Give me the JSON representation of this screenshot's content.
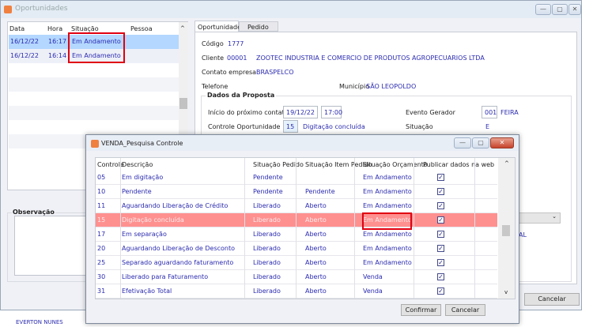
{
  "main_window": {
    "title": "Oportunidades",
    "min": "—",
    "max": "▢",
    "close": "✕"
  },
  "list": {
    "headers": [
      "Data",
      "Hora",
      "Situação",
      "Pessoa"
    ],
    "rows": [
      {
        "data": "16/12/22",
        "hora": "16:17",
        "situacao": "Em Andamento",
        "pessoa": ""
      },
      {
        "data": "16/12/22",
        "hora": "16:14",
        "situacao": "Em Andamento",
        "pessoa": ""
      }
    ],
    "scroll_up": "^"
  },
  "observacao_label": "Observação",
  "tabs": [
    "Oportunidade",
    "Pedido"
  ],
  "form": {
    "codigo_label": "Código",
    "codigo": "1777",
    "cliente_label": "Cliente",
    "cliente_codigo": "00001",
    "cliente_nome": "ZOOTEC INDUSTRIA E COMERCIO DE PRODUTOS AGROPECUARIOS LTDA",
    "contato_label": "Contato empresa",
    "contato": "BRASPELCO",
    "telefone_label": "Telefone",
    "municipio_label": "Município",
    "municipio": "SÃO LEOPOLDO",
    "group_title": "Dados da Proposta",
    "inicio_label": "Início do próximo contato",
    "inicio_data": "19/12/22",
    "inicio_hora": "17:00",
    "evento_label": "Evento Gerador",
    "evento_codigo": "001",
    "evento_nome": "FEIRA",
    "controle_label": "Controle Oportunidade",
    "controle_codigo": "15",
    "controle_desc": "Digitação concluída",
    "situacao_label": "Situação",
    "situacao": "E",
    "partial_text": "AL"
  },
  "main_cancel": "Cancelar",
  "footer_text": "EVERTON NUNES",
  "dialog": {
    "title": "VENDA_Pesquisa Controle",
    "min": "—",
    "max": "▢",
    "close": "✕",
    "headers": [
      "Controle",
      "Descrição",
      "Situação Pedido",
      "Situação Item Pedido",
      "Situação Orçamento",
      "Publicar dados na web"
    ],
    "rows": [
      {
        "controle": "05",
        "descricao": "Em digitação",
        "sit_pedido": "Pendente",
        "sit_item": "",
        "sit_orc": "Em Andamento",
        "publicar": true
      },
      {
        "controle": "10",
        "descricao": "Pendente",
        "sit_pedido": "Pendente",
        "sit_item": "Pendente",
        "sit_orc": "Em Andamento",
        "publicar": true
      },
      {
        "controle": "11",
        "descricao": "Aguardando Liberação de Crédito",
        "sit_pedido": "Liberado",
        "sit_item": "Aberto",
        "sit_orc": "Em Andamento",
        "publicar": true
      },
      {
        "controle": "15",
        "descricao": "Digitação concluída",
        "sit_pedido": "Liberado",
        "sit_item": "Aberto",
        "sit_orc": "Em Andamento",
        "publicar": true
      },
      {
        "controle": "17",
        "descricao": "Em separação",
        "sit_pedido": "Liberado",
        "sit_item": "Aberto",
        "sit_orc": "Em Andamento",
        "publicar": true
      },
      {
        "controle": "20",
        "descricao": "Aguardando Liberação de Desconto",
        "sit_pedido": "Liberado",
        "sit_item": "Aberto",
        "sit_orc": "Em Andamento",
        "publicar": true
      },
      {
        "controle": "25",
        "descricao": "Separado aguardando faturamento",
        "sit_pedido": "Liberado",
        "sit_item": "Aberto",
        "sit_orc": "Em Andamento",
        "publicar": true
      },
      {
        "controle": "30",
        "descricao": "Liberado para Faturamento",
        "sit_pedido": "Liberado",
        "sit_item": "Aberto",
        "sit_orc": "Venda",
        "publicar": true
      },
      {
        "controle": "31",
        "descricao": "Efetivação Total",
        "sit_pedido": "Liberado",
        "sit_item": "Aberto",
        "sit_orc": "Venda",
        "publicar": true
      }
    ],
    "selected_index": 3,
    "confirm": "Confirmar",
    "cancel": "Cancelar",
    "scroll_up": "^",
    "scroll_down": "v"
  },
  "colors": {
    "selected_row": "#ff9090",
    "list_selected": "#b3d7ff",
    "highlight_box": "#e00010",
    "value_text": "#2b2bb0"
  }
}
